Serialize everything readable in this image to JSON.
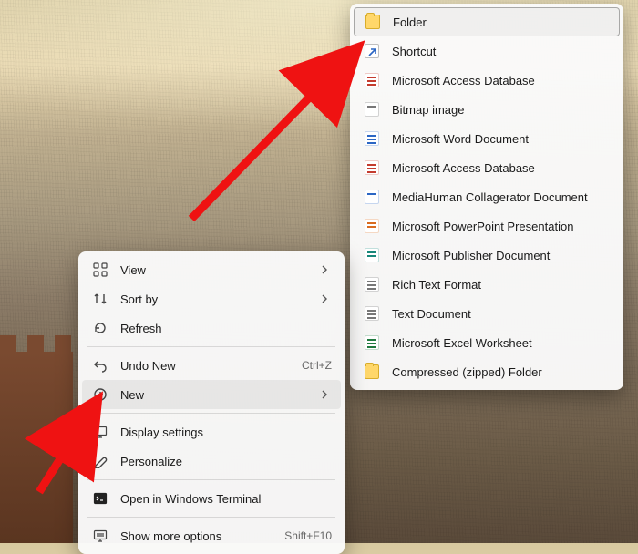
{
  "contextMenu": {
    "view": {
      "label": "View"
    },
    "sortBy": {
      "label": "Sort by"
    },
    "refresh": {
      "label": "Refresh"
    },
    "undo": {
      "label": "Undo New",
      "shortcut": "Ctrl+Z"
    },
    "new": {
      "label": "New"
    },
    "displaySettings": {
      "label": "Display settings"
    },
    "personalize": {
      "label": "Personalize"
    },
    "openTerminal": {
      "label": "Open in Windows Terminal"
    },
    "moreOptions": {
      "label": "Show more options",
      "shortcut": "Shift+F10"
    }
  },
  "newSubmenu": {
    "folder": "Folder",
    "shortcut": "Shortcut",
    "accessDb1": "Microsoft Access Database",
    "bitmap": "Bitmap image",
    "wordDoc": "Microsoft Word Document",
    "accessDb2": "Microsoft Access Database",
    "mediaHuman": "MediaHuman Collagerator Document",
    "powerpoint": "Microsoft PowerPoint Presentation",
    "publisher": "Microsoft Publisher Document",
    "rtf": "Rich Text Format",
    "textDoc": "Text Document",
    "excel": "Microsoft Excel Worksheet",
    "zipped": "Compressed (zipped) Folder"
  },
  "annotations": {
    "arrowColor": "#ef1212"
  }
}
